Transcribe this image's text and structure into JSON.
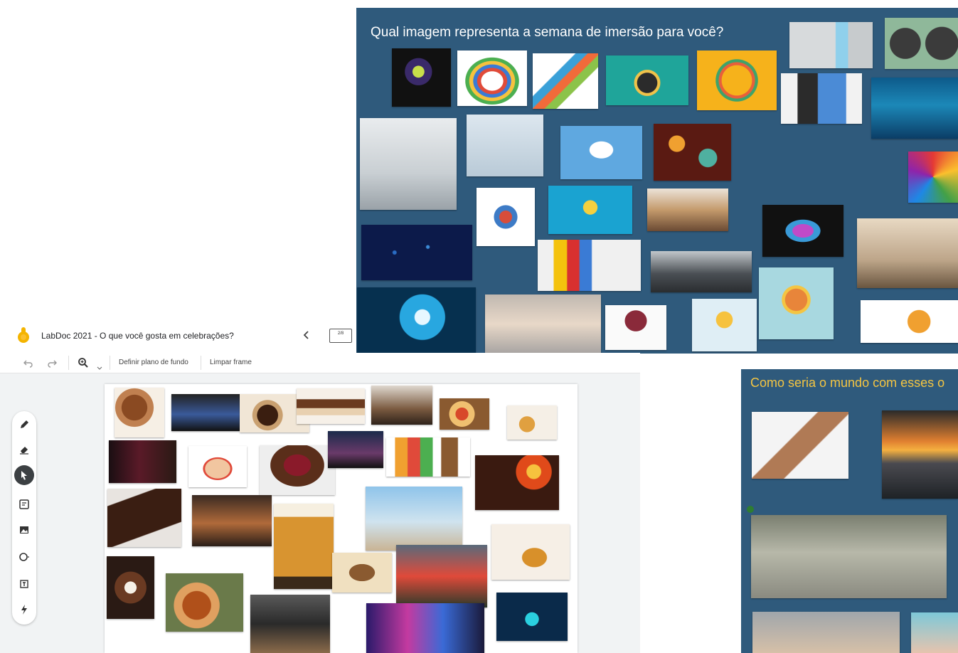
{
  "app": {
    "title": "LabDoc 2021 - O que você gosta em celebrações?",
    "frame_counter": "2/8"
  },
  "toolbar": {
    "set_background_label": "Definir plano de fundo",
    "clear_frame_label": "Limpar frame"
  },
  "boards": {
    "top_right_question": "Qual imagem representa a semana de imersão para você?",
    "bottom_right_question": "Como seria o mundo com esses o"
  },
  "icons": {
    "logo": "jamboard-logo-icon",
    "undo": "undo-icon",
    "redo": "redo-icon",
    "zoom": "zoom-icon",
    "collapse": "chevron-left-icon",
    "frames": "frames-icon",
    "pen": "pen-icon",
    "eraser": "eraser-icon",
    "select": "cursor-icon",
    "sticky": "sticky-note-icon",
    "image": "image-icon",
    "shape": "circle-icon",
    "textbox": "textbox-icon",
    "laser": "laser-icon"
  },
  "colors": {
    "board": "#2f5a7c",
    "title_white": "#ffffff",
    "title_yellow": "#f4c542",
    "logo": "#f4b400"
  }
}
